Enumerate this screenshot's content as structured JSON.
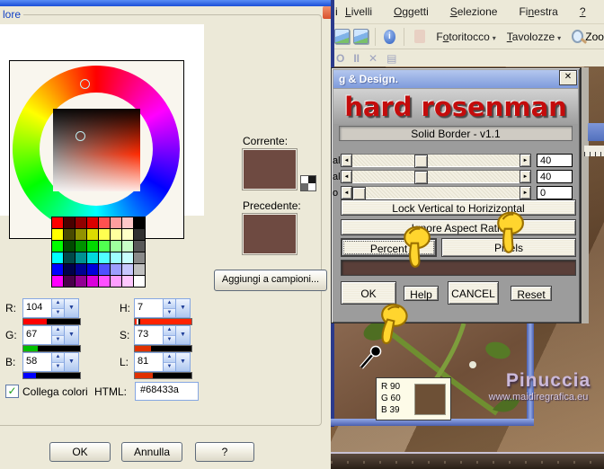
{
  "icons": {
    "close": "✕",
    "dropdown": "▼",
    "spin_up": "▲",
    "spin_down": "▼",
    "left_arrow": "◄",
    "right_arrow": "►",
    "check": "✓",
    "info": "i",
    "record": "O",
    "pause": "II",
    "stop": "✕",
    "save": "▤",
    "menu_arrow": "▾"
  },
  "color_dialog": {
    "title_fragment": "lore",
    "current_label": "Corrente:",
    "previous_label": "Precedente:",
    "current_color": "#6e4a41",
    "previous_color": "#6e4a41",
    "add_button": "Aggiungi a campioni...",
    "link_colors_label": "Collega colori",
    "html_label": "HTML:",
    "html_value": "#68433a",
    "fields": {
      "r": {
        "label": "R:",
        "value": "104",
        "fill": "#ff0000",
        "pct": 41
      },
      "g": {
        "label": "G:",
        "value": "67",
        "fill": "#00c000",
        "pct": 26
      },
      "b": {
        "label": "B:",
        "value": "58",
        "fill": "#0000ff",
        "pct": 23
      },
      "h": {
        "label": "H:",
        "value": "7",
        "fill": "#ff2200",
        "pct": 100
      },
      "s": {
        "label": "S:",
        "value": "73",
        "fill": "#e03000",
        "pct": 29
      },
      "l": {
        "label": "L:",
        "value": "81",
        "fill": "#e03000",
        "pct": 32
      }
    },
    "buttons": {
      "ok": "OK",
      "cancel": "Annulla",
      "help": "?"
    },
    "palette_rows": [
      [
        "#ff0000",
        "#490000",
        "#920000",
        "#db0000",
        "#ff5050",
        "#ff9e9e",
        "#ffc8c8",
        "#000000"
      ],
      [
        "#ffff00",
        "#494900",
        "#929200",
        "#dbdb00",
        "#ffff50",
        "#ffff9e",
        "#ffffc8",
        "#303030"
      ],
      [
        "#00ff00",
        "#004900",
        "#009200",
        "#00db00",
        "#50ff50",
        "#9eff9e",
        "#c8ffc8",
        "#585858"
      ],
      [
        "#00ffff",
        "#004949",
        "#009292",
        "#00dbdb",
        "#50ffff",
        "#9effff",
        "#c8ffff",
        "#8a8a8a"
      ],
      [
        "#0000ff",
        "#000049",
        "#000092",
        "#0000db",
        "#5050ff",
        "#9e9eff",
        "#c8c8ff",
        "#c0c0c0"
      ],
      [
        "#ff00ff",
        "#490049",
        "#920092",
        "#db00db",
        "#ff50ff",
        "#ff9eff",
        "#ffc8ff",
        "#ffffff"
      ]
    ]
  },
  "app": {
    "menu_fragment": "i",
    "menus": [
      {
        "label": "Livelli",
        "mnemonic": 0
      },
      {
        "label": "Oggetti",
        "mnemonic": 0
      },
      {
        "label": "Selezione",
        "mnemonic": 0
      },
      {
        "label": "Finestra",
        "mnemonic": 2
      },
      {
        "label": "?",
        "mnemonic": 0
      }
    ],
    "toolbar": {
      "fotoritocco": {
        "label": "Fotoritocco",
        "mnemonic": 1
      },
      "tavolozze": {
        "label": "Tavolozze",
        "mnemonic": 0
      },
      "zoom_label": "Zoo"
    }
  },
  "plugin": {
    "window_title": "g & Design.",
    "brand": "hard rosenman",
    "version_bar": "Solid Border - v1.1",
    "sliders": [
      {
        "fragment": "al",
        "value": "40",
        "thumb_pct": 37
      },
      {
        "fragment": "al",
        "value": "40",
        "thumb_pct": 37
      },
      {
        "fragment": "o",
        "value": "0",
        "thumb_pct": 0
      }
    ],
    "lock_button": "Lock Vertical to Horizizontal",
    "ignore_button": "Ignore Aspect Ratio",
    "percent_button": "Percent",
    "pixels_button": "Pixels",
    "color_bar": "#5a3f39",
    "ok": "OK",
    "help": "Help",
    "cancel": "CANCEL",
    "reset": "Reset"
  },
  "canvas": {
    "tooltip": {
      "line1": "R 90",
      "line2": "G 60",
      "line3": "B 39",
      "swatch": "#6d5036"
    },
    "watermark_name": "Pinuccia",
    "watermark_url": "www.maidiregrafica.eu"
  }
}
